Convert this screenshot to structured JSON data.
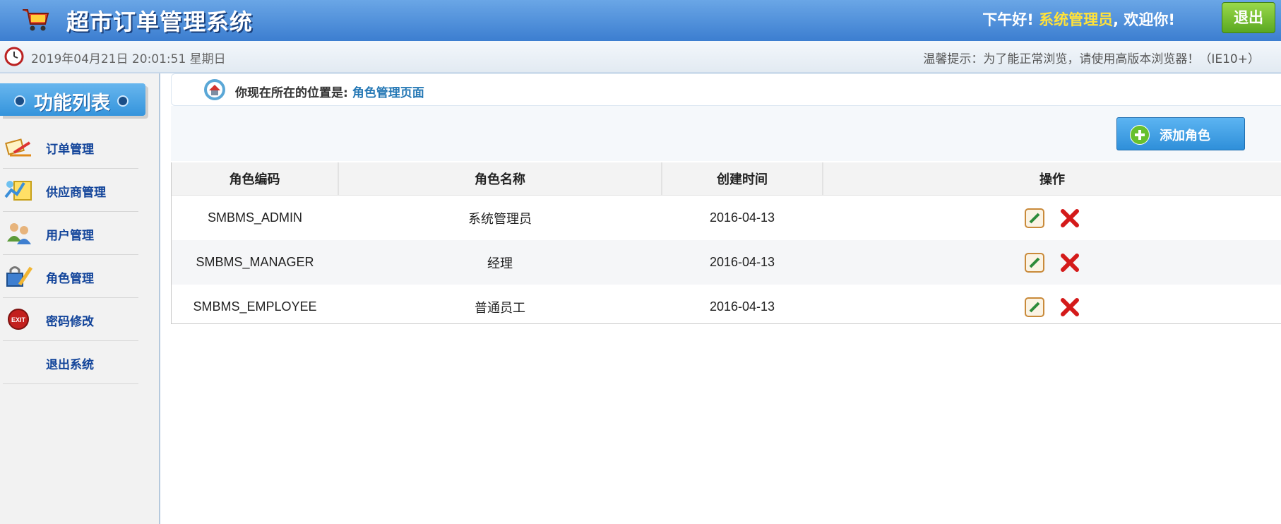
{
  "header": {
    "app_title": "超市订单管理系统",
    "greeting": "下午好!",
    "user_name": "系统管理员",
    "welcome": ", 欢迎你!",
    "logout_label": "退出",
    "cart_icon": "shopping-cart-icon"
  },
  "infobar": {
    "datetime": "2019年04月21日 20:01:51 星期日",
    "hint": "温馨提示：为了能正常浏览，请使用高版本浏览器！（IE10+）",
    "clock_icon": "clock-icon"
  },
  "sidebar": {
    "title": "功能列表",
    "items": [
      {
        "label": "订单管理",
        "icon": "order-icon"
      },
      {
        "label": "供应商管理",
        "icon": "supplier-icon"
      },
      {
        "label": "用户管理",
        "icon": "users-icon"
      },
      {
        "label": "角色管理",
        "icon": "role-lock-icon"
      },
      {
        "label": "密码修改",
        "icon": "exit-icon"
      },
      {
        "label": "退出系统",
        "icon": ""
      }
    ]
  },
  "breadcrumb": {
    "prefix": "你现在所在的位置是:",
    "current": "角色管理页面",
    "icon": "home-icon"
  },
  "toolbar": {
    "add_label": "添加角色",
    "add_icon": "plus-circle-icon"
  },
  "table": {
    "headers": [
      "角色编码",
      "角色名称",
      "创建时间",
      "操作"
    ],
    "rows": [
      {
        "code": "SMBMS_ADMIN",
        "name": "系统管理员",
        "created": "2016-04-13"
      },
      {
        "code": "SMBMS_MANAGER",
        "name": "经理",
        "created": "2016-04-13"
      },
      {
        "code": "SMBMS_EMPLOYEE",
        "name": "普通员工",
        "created": "2016-04-13"
      }
    ],
    "action_icons": [
      "edit-icon",
      "delete-icon"
    ]
  },
  "colors": {
    "header_top": "#6aa6e6",
    "header_bottom": "#3c7ed0",
    "username_yellow": "#ffe23a",
    "logout_green": "#5aa821",
    "menu_blue": "#12449a",
    "button_blue": "#2f8fd9",
    "delete_red": "#d41a1a"
  }
}
